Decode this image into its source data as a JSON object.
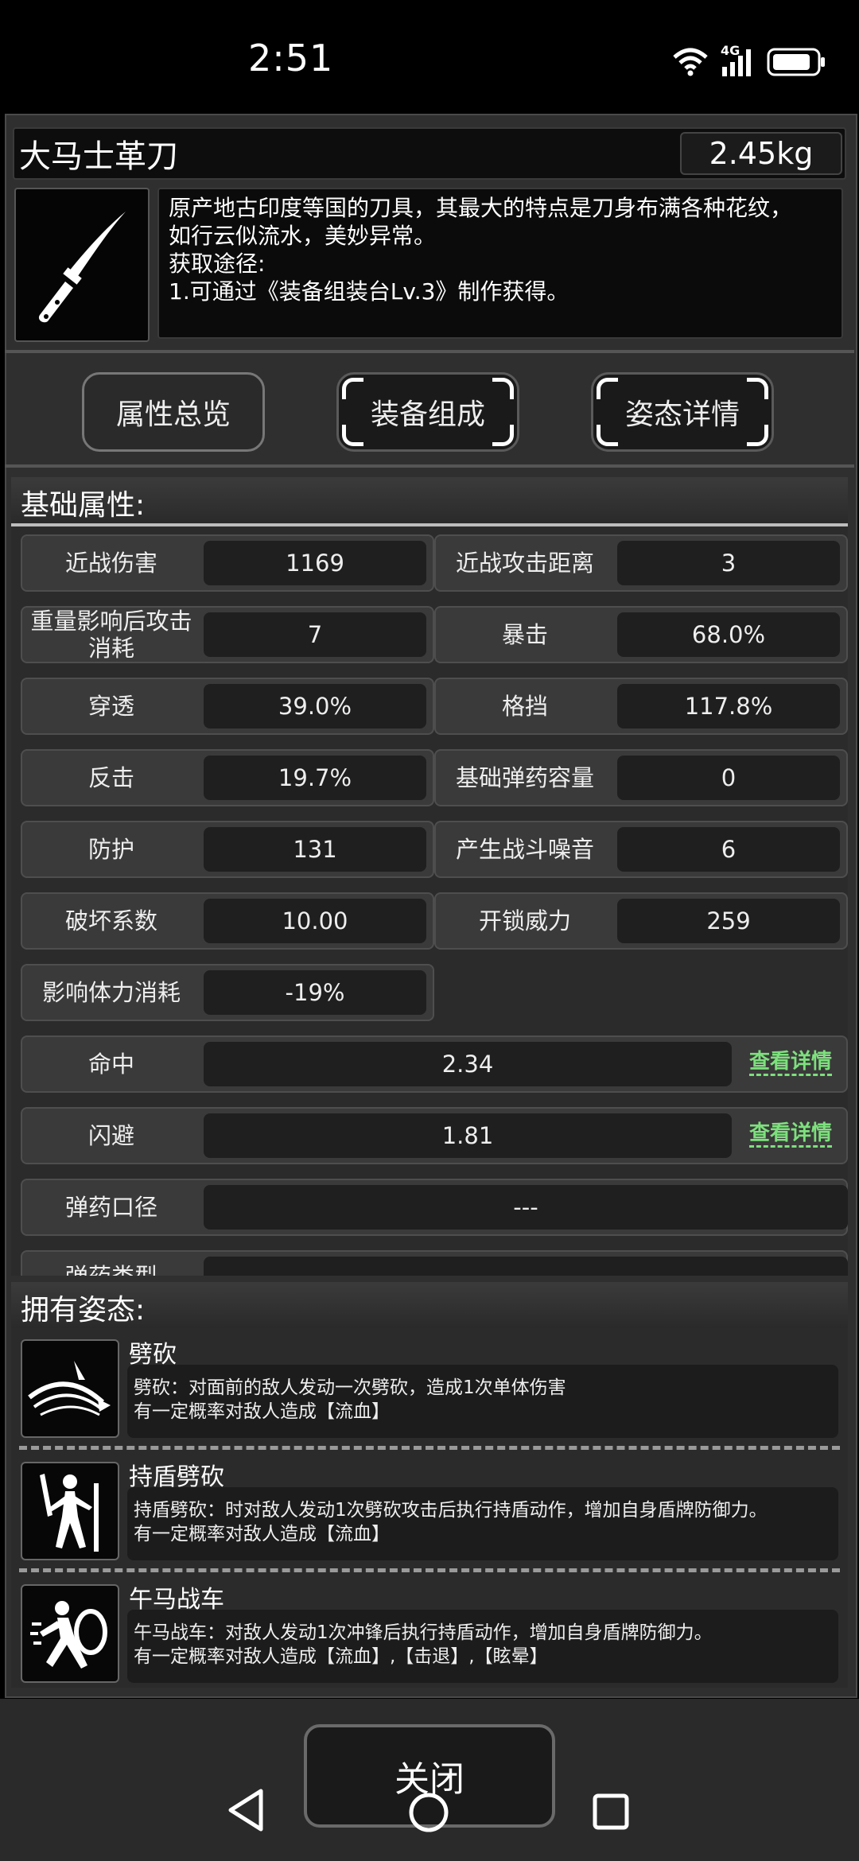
{
  "status": {
    "time": "2:51",
    "network": "4G",
    "icons": [
      "wifi-icon",
      "signal-icon",
      "battery-icon"
    ]
  },
  "item": {
    "name": "大马士革刀",
    "weight": "2.45kg",
    "icon": "knife-icon",
    "desc_lines": [
      "原产地古印度等国的刀具，其最大的特点是刀身布满各种花纹，",
      "如行云似流水，美妙异常。",
      "获取途径:",
      "1.可通过《装备组装台Lv.3》制作获得。"
    ]
  },
  "tabs": [
    {
      "label": "属性总览",
      "active": true
    },
    {
      "label": "装备组成",
      "active": false
    },
    {
      "label": "姿态详情",
      "active": false
    }
  ],
  "attributes": {
    "title": "基础属性:",
    "rows": [
      [
        {
          "label": "近战伤害",
          "value": "1169"
        },
        {
          "label": "近战攻击距离",
          "value": "3"
        }
      ],
      [
        {
          "label": "重量影响后攻击消耗",
          "value": "7"
        },
        {
          "label": "暴击",
          "value": "68.0%"
        }
      ],
      [
        {
          "label": "穿透",
          "value": "39.0%"
        },
        {
          "label": "格挡",
          "value": "117.8%"
        }
      ],
      [
        {
          "label": "反击",
          "value": "19.7%"
        },
        {
          "label": "基础弹药容量",
          "value": "0"
        }
      ],
      [
        {
          "label": "防护",
          "value": "131"
        },
        {
          "label": "产生战斗噪音",
          "value": "6"
        }
      ],
      [
        {
          "label": "破坏系数",
          "value": "10.00"
        },
        {
          "label": "开锁威力",
          "value": "259"
        }
      ],
      [
        {
          "label": "影响体力消耗",
          "value": "-19%"
        }
      ]
    ],
    "wide_rows": [
      {
        "label": "命中",
        "value": "2.34",
        "link": "查看详情"
      },
      {
        "label": "闪避",
        "value": "1.81",
        "link": "查看详情"
      },
      {
        "label": "弹药口径",
        "value": "---"
      },
      {
        "label": "弹药类型",
        "value": ""
      }
    ]
  },
  "stances": {
    "title": "拥有姿态:",
    "items": [
      {
        "name": "劈砍",
        "icon": "slash-icon",
        "desc1": "劈砍：对面前的敌人发动一次劈砍，造成1次单体伤害",
        "desc2": "有一定概率对敌人造成【流血】"
      },
      {
        "name": "持盾劈砍",
        "icon": "shield-slash-icon",
        "desc1": "持盾劈砍：时对敌人发动1次劈砍攻击后执行持盾动作，增加自身盾牌防御力。",
        "desc2": "有一定概率对敌人造成【流血】"
      },
      {
        "name": "午马战车",
        "icon": "shield-charge-icon",
        "desc1": "午马战车：对敌人发动1次冲锋后执行持盾动作，增加自身盾牌防御力。",
        "desc2": "有一定概率对敌人造成【流血】,【击退】,【眩晕】"
      }
    ]
  },
  "footer": {
    "close_label": "关闭"
  }
}
